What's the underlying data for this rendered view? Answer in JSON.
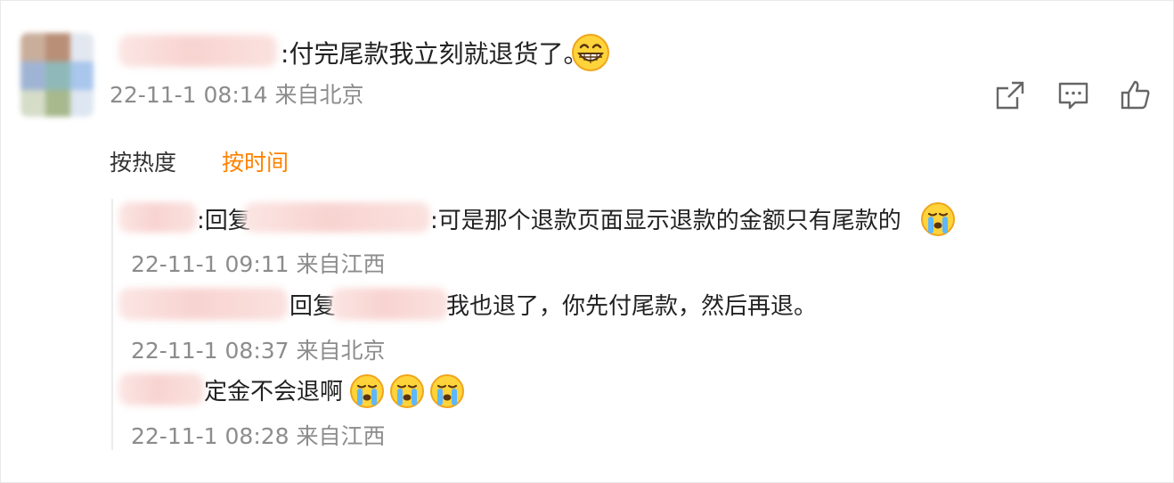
{
  "comment": {
    "prefix": ":",
    "text": "付完尾款我立刻就退货了。",
    "emoji": "grinning-face-icon",
    "time": "22-11-1 08:14",
    "location": "来自北京",
    "actions": [
      "share-icon",
      "comment-icon",
      "like-icon"
    ]
  },
  "sort": {
    "by_hot": "按热度",
    "by_time": "按时间",
    "active_color": "#ff8200"
  },
  "replies": [
    {
      "prefix": ":回复",
      "text": ":可是那个退款页面显示退款的金额只有尾款的",
      "emoji": "crying-face-icon",
      "time": "22-11-1 09:11",
      "location": "来自江西"
    },
    {
      "prefix": "回复",
      "text": "我也退了，你先付尾款，然后再退。",
      "time": "22-11-1 08:37",
      "location": "来自北京"
    },
    {
      "text": "定金不会退啊",
      "emoji": "crying-face-icon",
      "emoji_count": 3,
      "time": "22-11-1 08:28",
      "location": "来自江西"
    }
  ],
  "colors": {
    "text": "#222222",
    "meta": "#8c8c8c",
    "accent": "#ff8200",
    "blur": "#f8d3d0"
  }
}
